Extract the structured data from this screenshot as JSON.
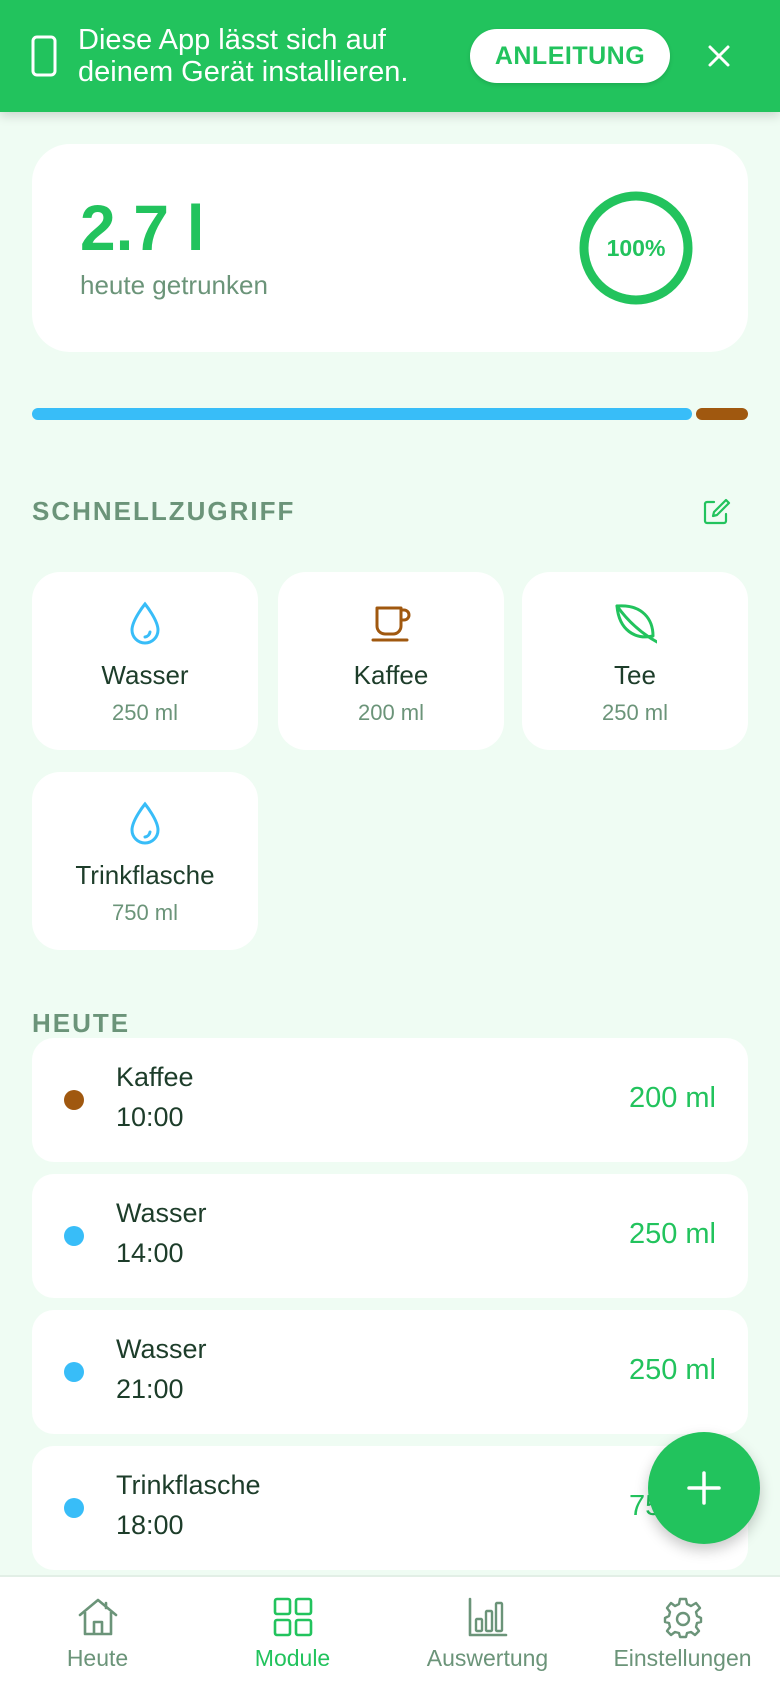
{
  "banner": {
    "message": "Diese App lässt sich auf deinem Gerät installieren.",
    "button_label": "ANLEITUNG",
    "icon": "phone-icon",
    "close_icon": "close-icon"
  },
  "summary": {
    "amount": "2.7 l",
    "subtitle": "heute getrunken",
    "percent_label": "100%",
    "percent_value": 100
  },
  "progress": {
    "segments": [
      {
        "drink": "Wasser",
        "color": "#38bdf8"
      },
      {
        "drink": "Kaffee",
        "color": "#a0580f"
      }
    ]
  },
  "quick_access": {
    "title": "SCHNELLZUGRIFF",
    "edit_icon": "edit-icon",
    "tiles": [
      {
        "name": "Wasser",
        "volume": "250 ml",
        "icon": "water-drop-icon",
        "color": "#38bdf8"
      },
      {
        "name": "Kaffee",
        "volume": "200 ml",
        "icon": "coffee-cup-icon",
        "color": "#a0580f"
      },
      {
        "name": "Tee",
        "volume": "250 ml",
        "icon": "leaf-icon",
        "color": "#22c35d"
      },
      {
        "name": "Trinkflasche",
        "volume": "750 ml",
        "icon": "water-drop-icon",
        "color": "#38bdf8"
      }
    ]
  },
  "today": {
    "title": "HEUTE",
    "entries": [
      {
        "name": "Kaffee",
        "time": "10:00",
        "volume": "200 ml",
        "color": "#a0580f"
      },
      {
        "name": "Wasser",
        "time": "14:00",
        "volume": "250 ml",
        "color": "#38bdf8"
      },
      {
        "name": "Wasser",
        "time": "21:00",
        "volume": "250 ml",
        "color": "#38bdf8"
      },
      {
        "name": "Trinkflasche",
        "time": "18:00",
        "volume": "750 ml",
        "color": "#38bdf8"
      }
    ]
  },
  "fab": {
    "icon": "plus-icon"
  },
  "nav": {
    "items": [
      {
        "label": "Heute",
        "icon": "home-icon"
      },
      {
        "label": "Module",
        "icon": "grid-icon"
      },
      {
        "label": "Auswertung",
        "icon": "bar-chart-icon"
      },
      {
        "label": "Einstellungen",
        "icon": "gear-icon"
      }
    ],
    "active": "Module"
  },
  "colors": {
    "accent": "#22c35d",
    "background": "#effcf3",
    "muted_text": "#6b9479",
    "water": "#38bdf8",
    "coffee": "#a0580f"
  }
}
